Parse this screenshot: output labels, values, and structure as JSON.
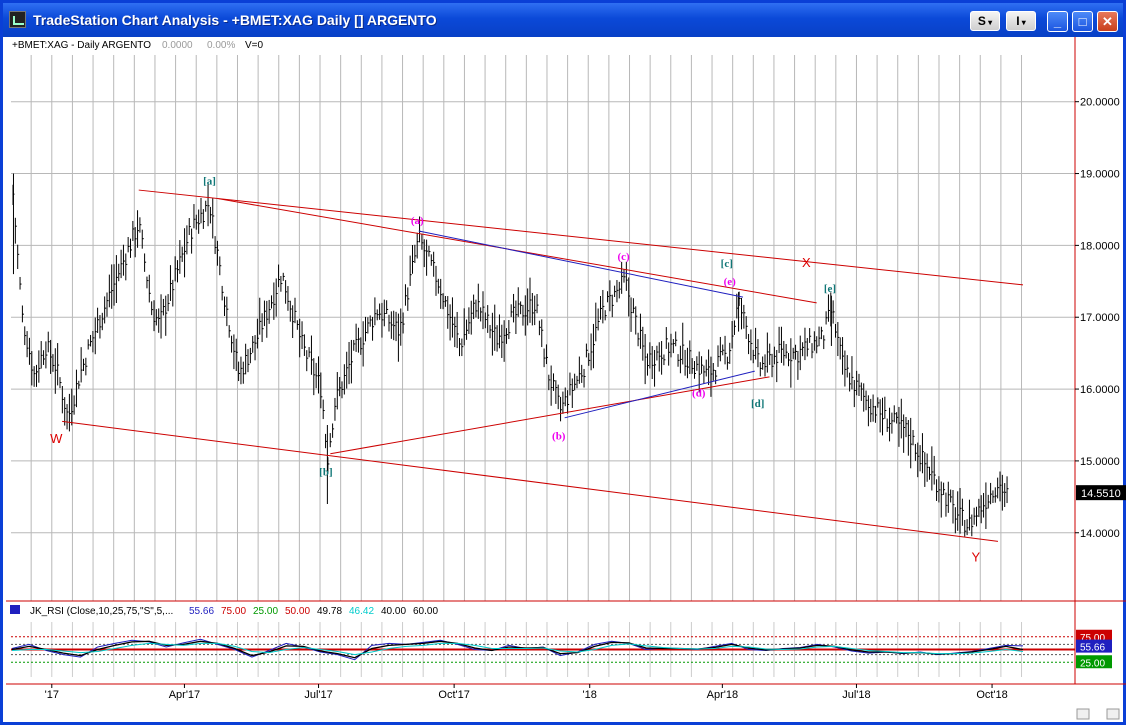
{
  "window": {
    "title": "TradeStation Chart Analysis - +BMET:XAG Daily [] ARGENTO",
    "buttons": {
      "s": "S",
      "i": "I"
    },
    "controls": {
      "minimize": "_",
      "maximize": "□",
      "close": "✕"
    }
  },
  "chart_data": [
    {
      "type": "bar",
      "header": "+BMET:XAG - Daily ARGENTO",
      "header_values": [
        "0.0000",
        "0.00%",
        "V=0"
      ],
      "y_ticks": [
        "14.0000",
        "15.0000",
        "16.0000",
        "17.0000",
        "18.0000",
        "19.0000",
        "20.0000"
      ],
      "ylim": [
        13.05,
        20.65
      ],
      "x_ticks": [
        "'17",
        "Apr'17",
        "Jul'17",
        "Oct'17",
        "'18",
        "Apr'18",
        "Jul'18",
        "Oct'18"
      ],
      "last_price": "14.5510",
      "colors": {
        "bars": "#000000",
        "channel": "#cc0000",
        "trend": "#1f1fbf",
        "wave_red": "#dd0000",
        "wave_teal": "#117777",
        "wave_magenta": "#ee00ee"
      },
      "price_path": [
        {
          "x": "2016-12-05",
          "y": 18.9
        },
        {
          "x": "2016-12-12",
          "y": 17.0
        },
        {
          "x": "2016-12-20",
          "y": 16.2
        },
        {
          "x": "2016-12-28",
          "y": 16.6
        },
        {
          "x": "2017-01-04",
          "y": 16.3
        },
        {
          "x": "2017-01-12",
          "y": 15.6
        },
        {
          "x": "2017-01-20",
          "y": 16.2
        },
        {
          "x": "2017-02-01",
          "y": 16.9
        },
        {
          "x": "2017-02-15",
          "y": 17.6
        },
        {
          "x": "2017-03-01",
          "y": 18.3
        },
        {
          "x": "2017-03-10",
          "y": 17.1
        },
        {
          "x": "2017-03-15",
          "y": 16.9
        },
        {
          "x": "2017-03-25",
          "y": 17.5
        },
        {
          "x": "2017-04-05",
          "y": 18.2
        },
        {
          "x": "2017-04-18",
          "y": 18.6
        },
        {
          "x": "2017-04-28",
          "y": 17.3
        },
        {
          "x": "2017-05-08",
          "y": 16.2
        },
        {
          "x": "2017-05-20",
          "y": 16.7
        },
        {
          "x": "2017-06-06",
          "y": 17.6
        },
        {
          "x": "2017-06-20",
          "y": 16.6
        },
        {
          "x": "2017-07-03",
          "y": 16.0
        },
        {
          "x": "2017-07-07",
          "y": 15.0
        },
        {
          "x": "2017-07-12",
          "y": 15.8
        },
        {
          "x": "2017-07-25",
          "y": 16.5
        },
        {
          "x": "2017-08-10",
          "y": 17.1
        },
        {
          "x": "2017-08-25",
          "y": 16.8
        },
        {
          "x": "2017-09-07",
          "y": 18.1
        },
        {
          "x": "2017-09-20",
          "y": 17.5
        },
        {
          "x": "2017-10-05",
          "y": 16.6
        },
        {
          "x": "2017-10-16",
          "y": 17.2
        },
        {
          "x": "2017-10-30",
          "y": 16.7
        },
        {
          "x": "2017-11-10",
          "y": 17.0
        },
        {
          "x": "2017-11-25",
          "y": 17.2
        },
        {
          "x": "2017-12-04",
          "y": 16.2
        },
        {
          "x": "2017-12-12",
          "y": 15.7
        },
        {
          "x": "2017-12-28",
          "y": 16.3
        },
        {
          "x": "2018-01-10",
          "y": 17.1
        },
        {
          "x": "2018-01-25",
          "y": 17.5
        },
        {
          "x": "2018-02-08",
          "y": 16.4
        },
        {
          "x": "2018-02-25",
          "y": 16.6
        },
        {
          "x": "2018-03-10",
          "y": 16.4
        },
        {
          "x": "2018-03-22",
          "y": 16.2
        },
        {
          "x": "2018-04-05",
          "y": 16.5
        },
        {
          "x": "2018-04-12",
          "y": 17.2
        },
        {
          "x": "2018-04-20",
          "y": 16.7
        },
        {
          "x": "2018-04-26",
          "y": 16.3
        },
        {
          "x": "2018-05-10",
          "y": 16.5
        },
        {
          "x": "2018-05-22",
          "y": 16.5
        },
        {
          "x": "2018-06-08",
          "y": 16.7
        },
        {
          "x": "2018-06-14",
          "y": 17.1
        },
        {
          "x": "2018-06-22",
          "y": 16.3
        },
        {
          "x": "2018-07-05",
          "y": 15.9
        },
        {
          "x": "2018-07-20",
          "y": 15.6
        },
        {
          "x": "2018-08-05",
          "y": 15.4
        },
        {
          "x": "2018-08-15",
          "y": 15.0
        },
        {
          "x": "2018-08-28",
          "y": 14.6
        },
        {
          "x": "2018-09-05",
          "y": 14.3
        },
        {
          "x": "2018-09-15",
          "y": 14.1
        },
        {
          "x": "2018-09-25",
          "y": 14.4
        },
        {
          "x": "2018-10-05",
          "y": 14.7
        },
        {
          "x": "2018-10-12",
          "y": 14.5
        }
      ],
      "lines": [
        {
          "color": "#cc0000",
          "p1": {
            "x": "2017-03-01",
            "y": 18.77
          },
          "p2": {
            "x": "2018-10-22",
            "y": 17.45
          }
        },
        {
          "color": "#cc0000",
          "p1": {
            "x": "2017-01-08",
            "y": 15.55
          },
          "p2": {
            "x": "2018-10-05",
            "y": 13.88
          }
        },
        {
          "color": "#cc0000",
          "p1": {
            "x": "2017-04-24",
            "y": 18.65
          },
          "p2": {
            "x": "2018-06-04",
            "y": 17.2
          }
        },
        {
          "color": "#cc0000",
          "p1": {
            "x": "2017-07-09",
            "y": 15.1
          },
          "p2": {
            "x": "2018-05-03",
            "y": 16.17
          }
        },
        {
          "color": "#1f1fbf",
          "p1": {
            "x": "2017-09-07",
            "y": 18.2
          },
          "p2": {
            "x": "2018-04-15",
            "y": 17.28
          }
        },
        {
          "color": "#1f1fbf",
          "p1": {
            "x": "2017-12-15",
            "y": 15.6
          },
          "p2": {
            "x": "2018-04-23",
            "y": 16.25
          }
        }
      ],
      "wave_labels": [
        {
          "text": "W",
          "color": "#dd0000",
          "x": "2017-01-04",
          "y": 15.25
        },
        {
          "text": "[a]",
          "color": "#117777",
          "x": "2017-04-18",
          "y": 18.85
        },
        {
          "text": "[b]",
          "color": "#117777",
          "x": "2017-07-06",
          "y": 14.8
        },
        {
          "text": "(a)",
          "color": "#ee00ee",
          "x": "2017-09-06",
          "y": 18.3
        },
        {
          "text": "(b)",
          "color": "#ee00ee",
          "x": "2017-12-11",
          "y": 15.3
        },
        {
          "text": "(c)",
          "color": "#ee00ee",
          "x": "2018-01-24",
          "y": 17.8
        },
        {
          "text": "[c]",
          "color": "#117777",
          "x": "2018-04-04",
          "y": 17.7
        },
        {
          "text": "(d)",
          "color": "#ee00ee",
          "x": "2018-03-16",
          "y": 15.9
        },
        {
          "text": "(e)",
          "color": "#ee00ee",
          "x": "2018-04-06",
          "y": 17.45
        },
        {
          "text": "[d]",
          "color": "#117777",
          "x": "2018-04-25",
          "y": 15.75
        },
        {
          "text": "X",
          "color": "#dd0000",
          "x": "2018-05-28",
          "y": 17.7
        },
        {
          "text": "[e]",
          "color": "#117777",
          "x": "2018-06-13",
          "y": 17.35
        },
        {
          "text": "Y",
          "color": "#dd0000",
          "x": "2018-09-20",
          "y": 13.6
        }
      ]
    },
    {
      "type": "line",
      "header": "JK_RSI (Close,10,25,75,\"S\",5,...",
      "header_values": [
        {
          "text": "55.66",
          "color": "#1f1fbf"
        },
        {
          "text": "75.00",
          "color": "#cc0000"
        },
        {
          "text": "25.00",
          "color": "#009900"
        },
        {
          "text": "50.00",
          "color": "#cc0000"
        },
        {
          "text": "49.78",
          "color": "#000000"
        },
        {
          "text": "46.42",
          "color": "#00cccc"
        },
        {
          "text": "40.00",
          "color": "#000000"
        },
        {
          "text": "60.00",
          "color": "#000000"
        }
      ],
      "ylim": [
        0,
        100
      ],
      "levels": [
        {
          "value": 75,
          "color": "#cc0000",
          "style": "dotted"
        },
        {
          "value": 60,
          "color": "#555555",
          "style": "dotted"
        },
        {
          "value": 50,
          "color": "#cc0000",
          "style": "solid"
        },
        {
          "value": 40,
          "color": "#555555",
          "style": "dotted"
        },
        {
          "value": 25,
          "color": "#009900",
          "style": "dotted"
        }
      ],
      "axis_badges": [
        {
          "text": "75.00",
          "color": "#cc0000",
          "value": 75
        },
        {
          "text": "55.66",
          "color": "#1f1fbf",
          "value": 55.66
        },
        {
          "text": "25.00",
          "color": "#009900",
          "value": 25
        }
      ],
      "series": [
        {
          "name": "",
          "color": "#1f1fbf",
          "values": [
            52,
            60,
            48,
            40,
            35,
            55,
            62,
            68,
            65,
            55,
            63,
            70,
            60,
            50,
            35,
            48,
            62,
            55,
            45,
            40,
            30,
            58,
            62,
            60,
            64,
            68,
            60,
            50,
            48,
            58,
            52,
            55,
            38,
            45,
            60,
            66,
            62,
            50,
            53,
            52,
            50,
            56,
            62,
            50,
            48,
            52,
            54,
            60,
            55,
            47,
            43,
            45,
            42,
            45,
            40,
            43,
            46,
            52,
            58,
            57
          ]
        },
        {
          "name": "",
          "color": "#000000",
          "values": [
            50,
            56,
            50,
            43,
            38,
            50,
            58,
            65,
            66,
            58,
            60,
            66,
            62,
            52,
            38,
            45,
            57,
            56,
            47,
            42,
            34,
            52,
            58,
            60,
            62,
            66,
            62,
            53,
            48,
            55,
            53,
            54,
            42,
            44,
            56,
            64,
            63,
            53,
            52,
            52,
            51,
            54,
            60,
            53,
            49,
            51,
            53,
            58,
            56,
            49,
            45,
            45,
            43,
            44,
            41,
            42,
            45,
            50,
            56,
            50
          ]
        },
        {
          "name": "",
          "color": "#00cccc",
          "values": [
            48,
            50,
            50,
            47,
            44,
            46,
            52,
            58,
            62,
            60,
            58,
            62,
            62,
            56,
            46,
            44,
            50,
            54,
            50,
            46,
            40,
            45,
            52,
            56,
            58,
            62,
            62,
            58,
            52,
            52,
            52,
            53,
            47,
            45,
            50,
            58,
            61,
            57,
            54,
            52,
            51,
            52,
            56,
            55,
            51,
            50,
            51,
            55,
            56,
            52,
            48,
            46,
            44,
            44,
            42,
            42,
            43,
            46,
            50,
            46
          ]
        }
      ]
    }
  ]
}
